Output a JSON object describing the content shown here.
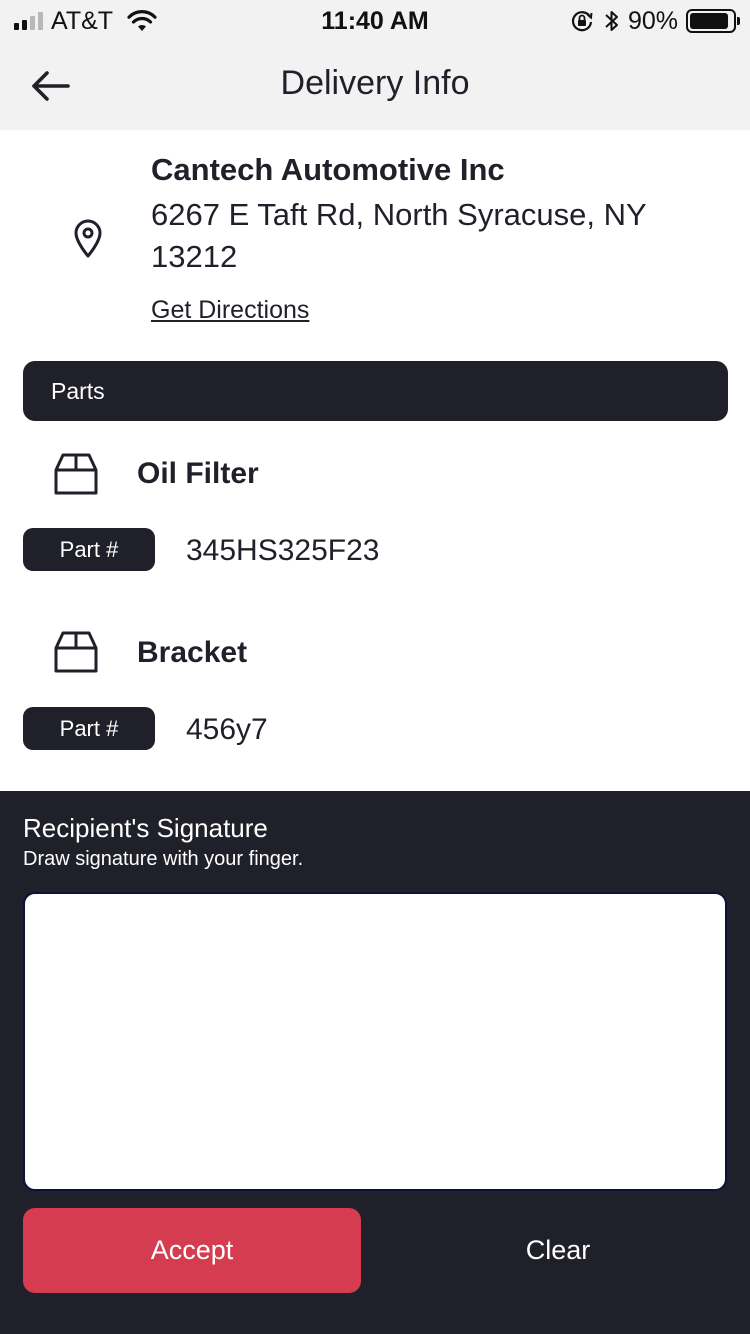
{
  "status_bar": {
    "carrier": "AT&T",
    "time": "11:40 AM",
    "battery_percent": "90%",
    "battery_level": 0.9,
    "signal_bars": 2,
    "icons": [
      "signal-icon",
      "wifi-icon",
      "orientation-lock-icon",
      "bluetooth-icon",
      "battery-icon"
    ]
  },
  "nav": {
    "title": "Delivery Info",
    "back_icon": "arrow-left-icon"
  },
  "destination": {
    "company": "Cantech Automotive Inc",
    "address": "6267 E Taft Rd, North Syracuse, NY 13212",
    "directions_label": "Get Directions",
    "icon": "map-pin-icon"
  },
  "parts": {
    "header": "Parts",
    "items": [
      {
        "name": "Oil Filter",
        "badge": "Part #",
        "number": "345HS325F23",
        "icon": "box-icon"
      },
      {
        "name": "Bracket",
        "badge": "Part #",
        "number": "456y7",
        "icon": "box-icon"
      }
    ]
  },
  "signature": {
    "title": "Recipient's Signature",
    "hint": "Draw signature with your finger.",
    "accept_label": "Accept",
    "clear_label": "Clear"
  },
  "colors": {
    "dark": "#1f2029",
    "accent": "#d63c4f",
    "header_bg": "#f2f2f2"
  }
}
